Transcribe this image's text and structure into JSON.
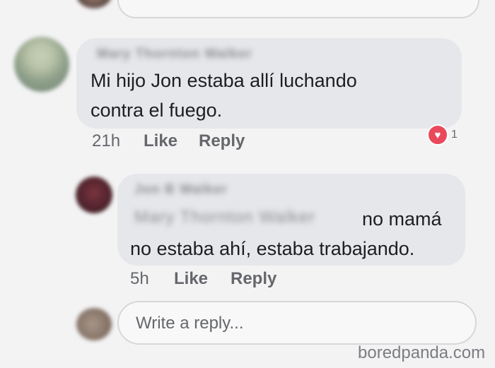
{
  "comment": {
    "text_line1": "Mi hijo Jon estaba allí luchando",
    "text_line2": "contra el fuego.",
    "time": "21h",
    "like_label": "Like",
    "reply_label": "Reply",
    "reaction": {
      "icon": "heart-icon",
      "count": "1",
      "color": "#e9495b"
    }
  },
  "reply": {
    "text_line1": "no mamá",
    "text_line2": "no estaba ahí, estaba trabajando.",
    "time": "5h",
    "like_label": "Like",
    "reply_label": "Reply"
  },
  "reply_box": {
    "placeholder": "Write a reply..."
  },
  "watermark": "boredpanda.com"
}
